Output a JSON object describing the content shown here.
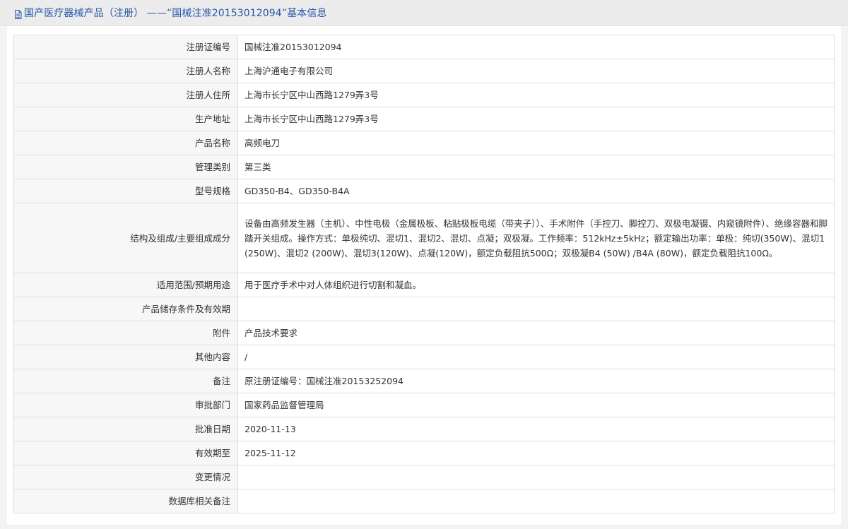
{
  "header": {
    "title": "国产医疗器械产品（注册） ——“国械注准20153012094”基本信息",
    "icon": "document-icon",
    "color": "#2557a8"
  },
  "rows": [
    {
      "label": "注册证编号",
      "value": "国械注准20153012094"
    },
    {
      "label": "注册人名称",
      "value": "上海沪通电子有限公司"
    },
    {
      "label": "注册人住所",
      "value": "上海市长宁区中山西路1279弄3号"
    },
    {
      "label": "生产地址",
      "value": "上海市长宁区中山西路1279弄3号"
    },
    {
      "label": "产品名称",
      "value": "高频电刀"
    },
    {
      "label": "管理类别",
      "value": "第三类"
    },
    {
      "label": "型号规格",
      "value": "GD350-B4、GD350-B4A"
    },
    {
      "label": "结构及组成/主要组成成分",
      "value": "设备由高频发生器（主机）、中性电极（金属极板、粘贴极板电缆（带夹子））、手术附件（手控刀、脚控刀、双极电凝镊、内窥镜附件）、绝缘容器和脚踏开关组成。操作方式：单极纯切、混切1、混切2、混切、点凝；双极凝。工作频率：512kHz±5kHz；额定输出功率：单极：纯切(350W)、混切1(250W)、混切2 (200W)、混切3(120W)、点凝(120W)，额定负载阻抗500Ω；双极凝B4 (50W) /B4A (80W)，额定负载阻抗100Ω。"
    },
    {
      "label": "适用范围/预期用途",
      "value": "用于医疗手术中对人体组织进行切割和凝血。"
    },
    {
      "label": "产品储存条件及有效期",
      "value": ""
    },
    {
      "label": "附件",
      "value": "产品技术要求"
    },
    {
      "label": "其他内容",
      "value": "/"
    },
    {
      "label": "备注",
      "value": "原注册证编号：国械注准20153252094"
    },
    {
      "label": "审批部门",
      "value": "国家药品监督管理局"
    },
    {
      "label": "批准日期",
      "value": "2020-11-13"
    },
    {
      "label": "有效期至",
      "value": "2025-11-12"
    },
    {
      "label": "变更情况",
      "value": ""
    },
    {
      "label": "数据库相关备注",
      "value": ""
    }
  ]
}
